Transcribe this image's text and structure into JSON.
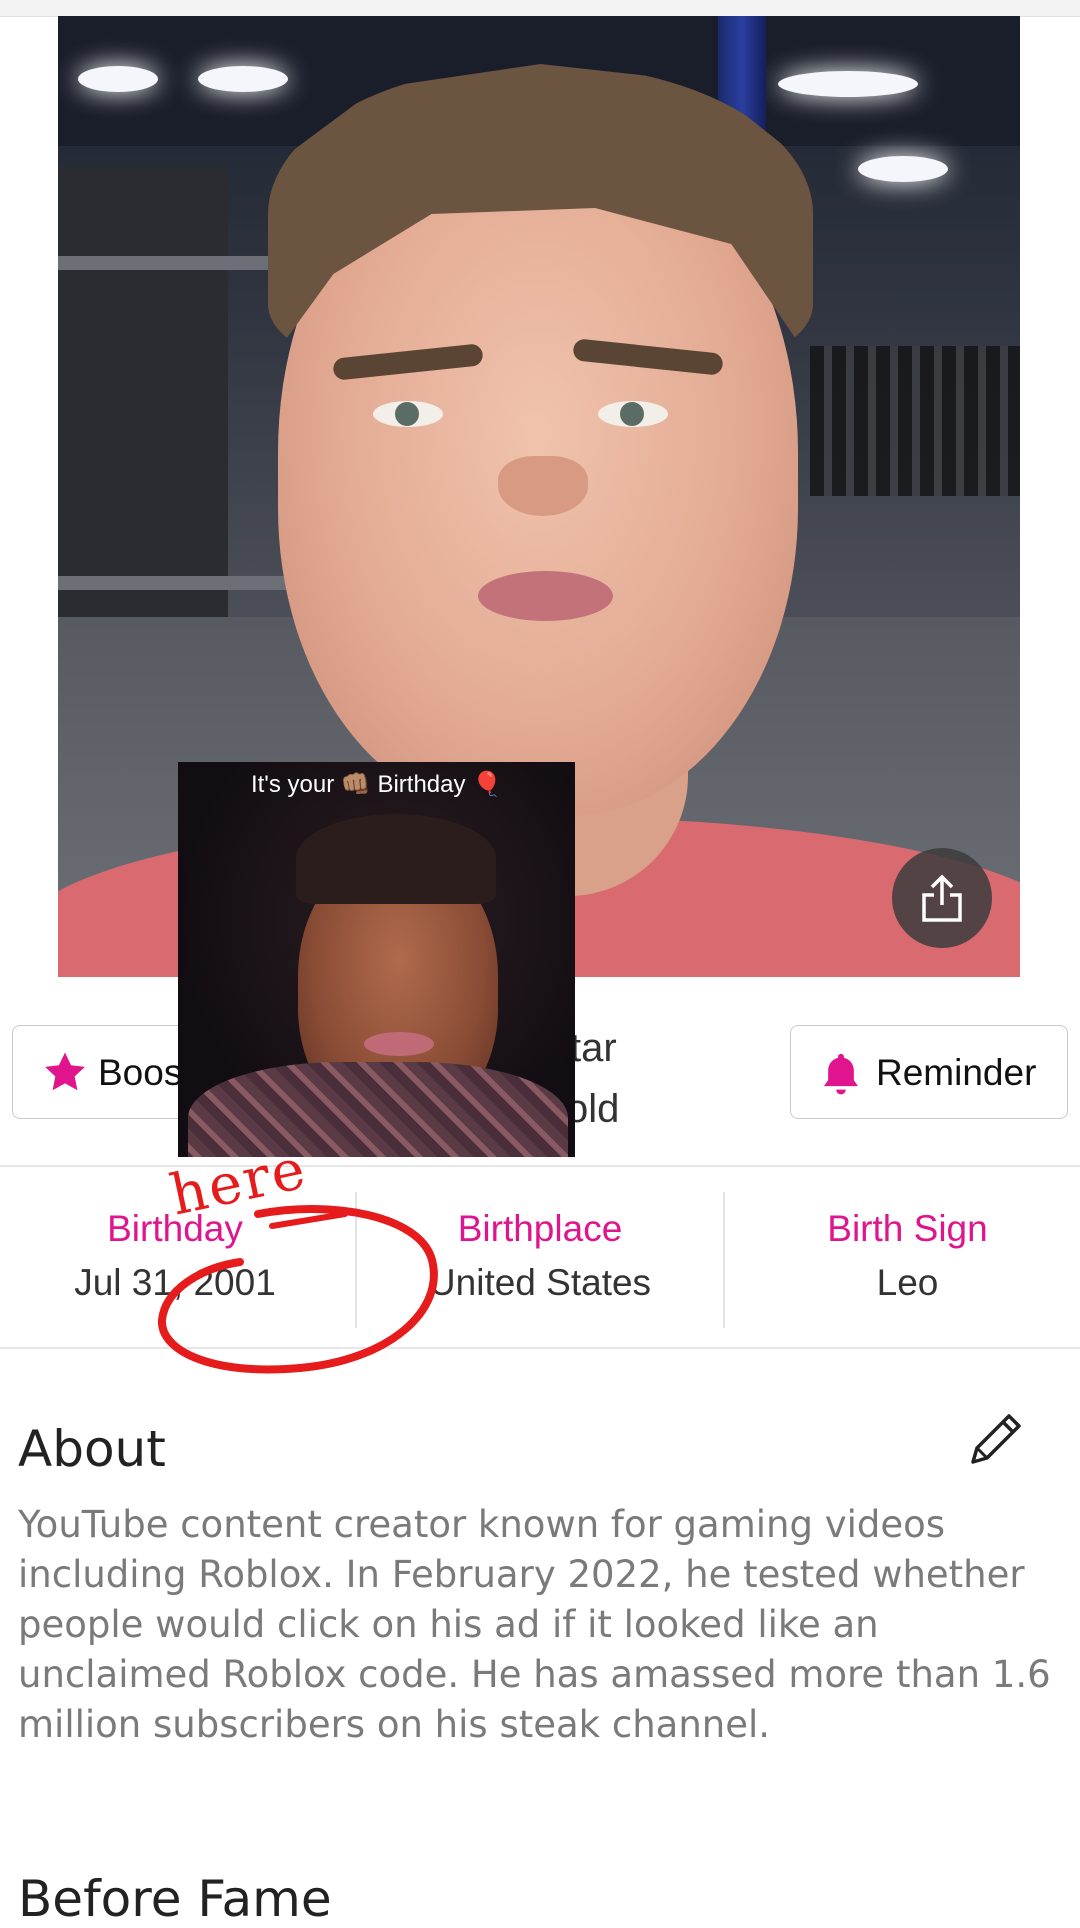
{
  "overlay": {
    "caption": "It's your 👊🏽 Birthday 🎈"
  },
  "actions": {
    "boost_label": "Boos",
    "reminder_label": "Reminder"
  },
  "middle": {
    "line1": "tar",
    "line2": "old"
  },
  "info": {
    "birthday": {
      "label": "Birthday",
      "value": "Jul 31, 2001"
    },
    "birthplace": {
      "label": "Birthplace",
      "value": "United States"
    },
    "birth_sign": {
      "label": "Birth Sign",
      "value": "Leo"
    }
  },
  "annotation": {
    "text": "here"
  },
  "about": {
    "title": "About",
    "text": "YouTube content creator known for gaming videos including Roblox. In February 2022, he tested whether people would click on his ad if it looked like an unclaimed Roblox code. He has amassed more than 1.6 million subscribers on his steak channel."
  },
  "before_fame": {
    "title": "Before Fame"
  },
  "colors": {
    "accent": "#e0148c",
    "annotation": "#e61b1b"
  },
  "icons": {
    "boost": "star-icon",
    "reminder": "bell-icon",
    "share": "share-icon",
    "edit": "pencil-icon"
  }
}
